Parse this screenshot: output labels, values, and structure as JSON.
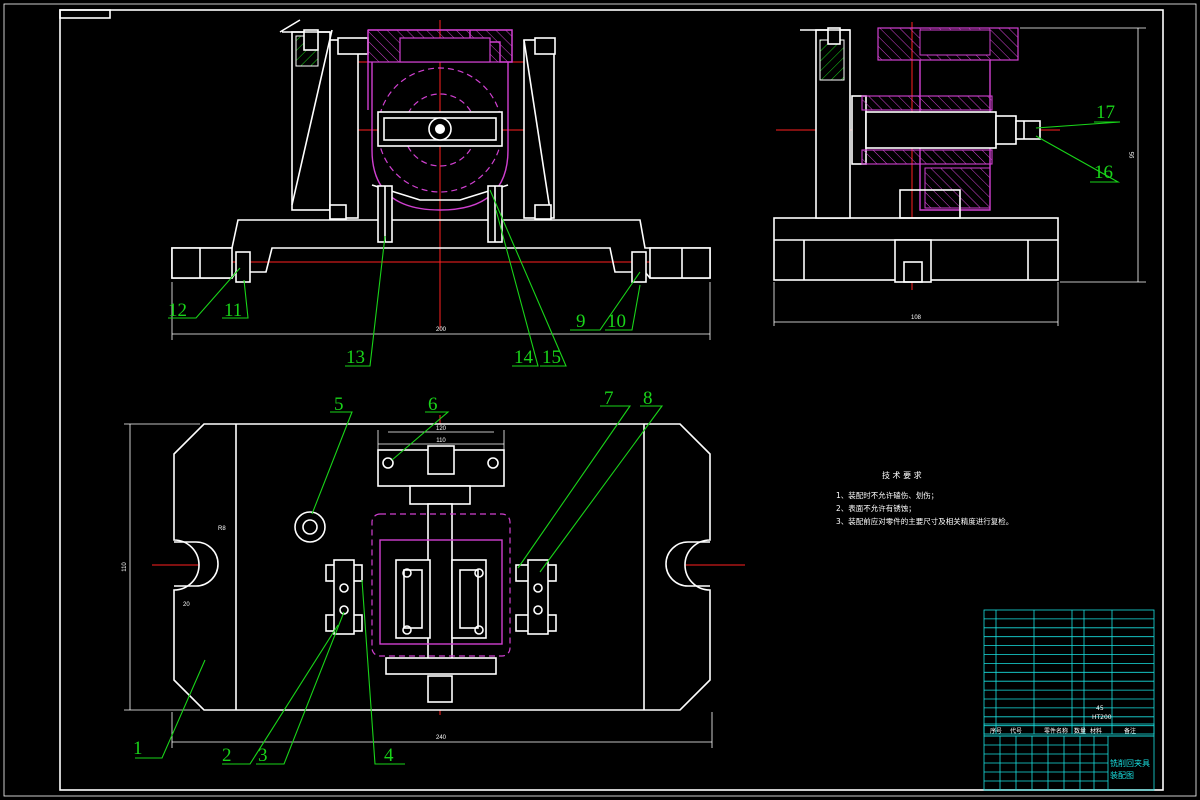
{
  "drawing": {
    "part_numbers": [
      "1",
      "2",
      "3",
      "4",
      "5",
      "6",
      "7",
      "8",
      "9",
      "10",
      "11",
      "12",
      "13",
      "14",
      "15",
      "16",
      "17"
    ],
    "dimensions": {
      "front_width": "200",
      "side_width": "108",
      "side_height": "95",
      "plan_width": "240",
      "plan_height": "110",
      "plan_slot": "110",
      "plan_top": "120",
      "plan_small_left": "20",
      "plan_small_r": "R8"
    },
    "technical_requirements": {
      "title": "技 术 要 求",
      "items": [
        "1、装配时不允许磕伤、划伤；",
        "2、表面不允许有锈蚀；",
        "3、装配前应对零件的主要尺寸及相关精度进行复检。"
      ]
    },
    "title_block": {
      "drawing_name": "铣削回夹具",
      "drawing_type": "装配图",
      "material": "45",
      "material2": "HT200",
      "header_cells": [
        "序号",
        "代号",
        "零件名称",
        "数量",
        "材料",
        "备注"
      ]
    },
    "colors": {
      "outline": "#ffffff",
      "centerline": "#ff2020",
      "workpiece": "#d040d0",
      "leader": "#19d419",
      "titleblock": "#19e0e0"
    }
  }
}
